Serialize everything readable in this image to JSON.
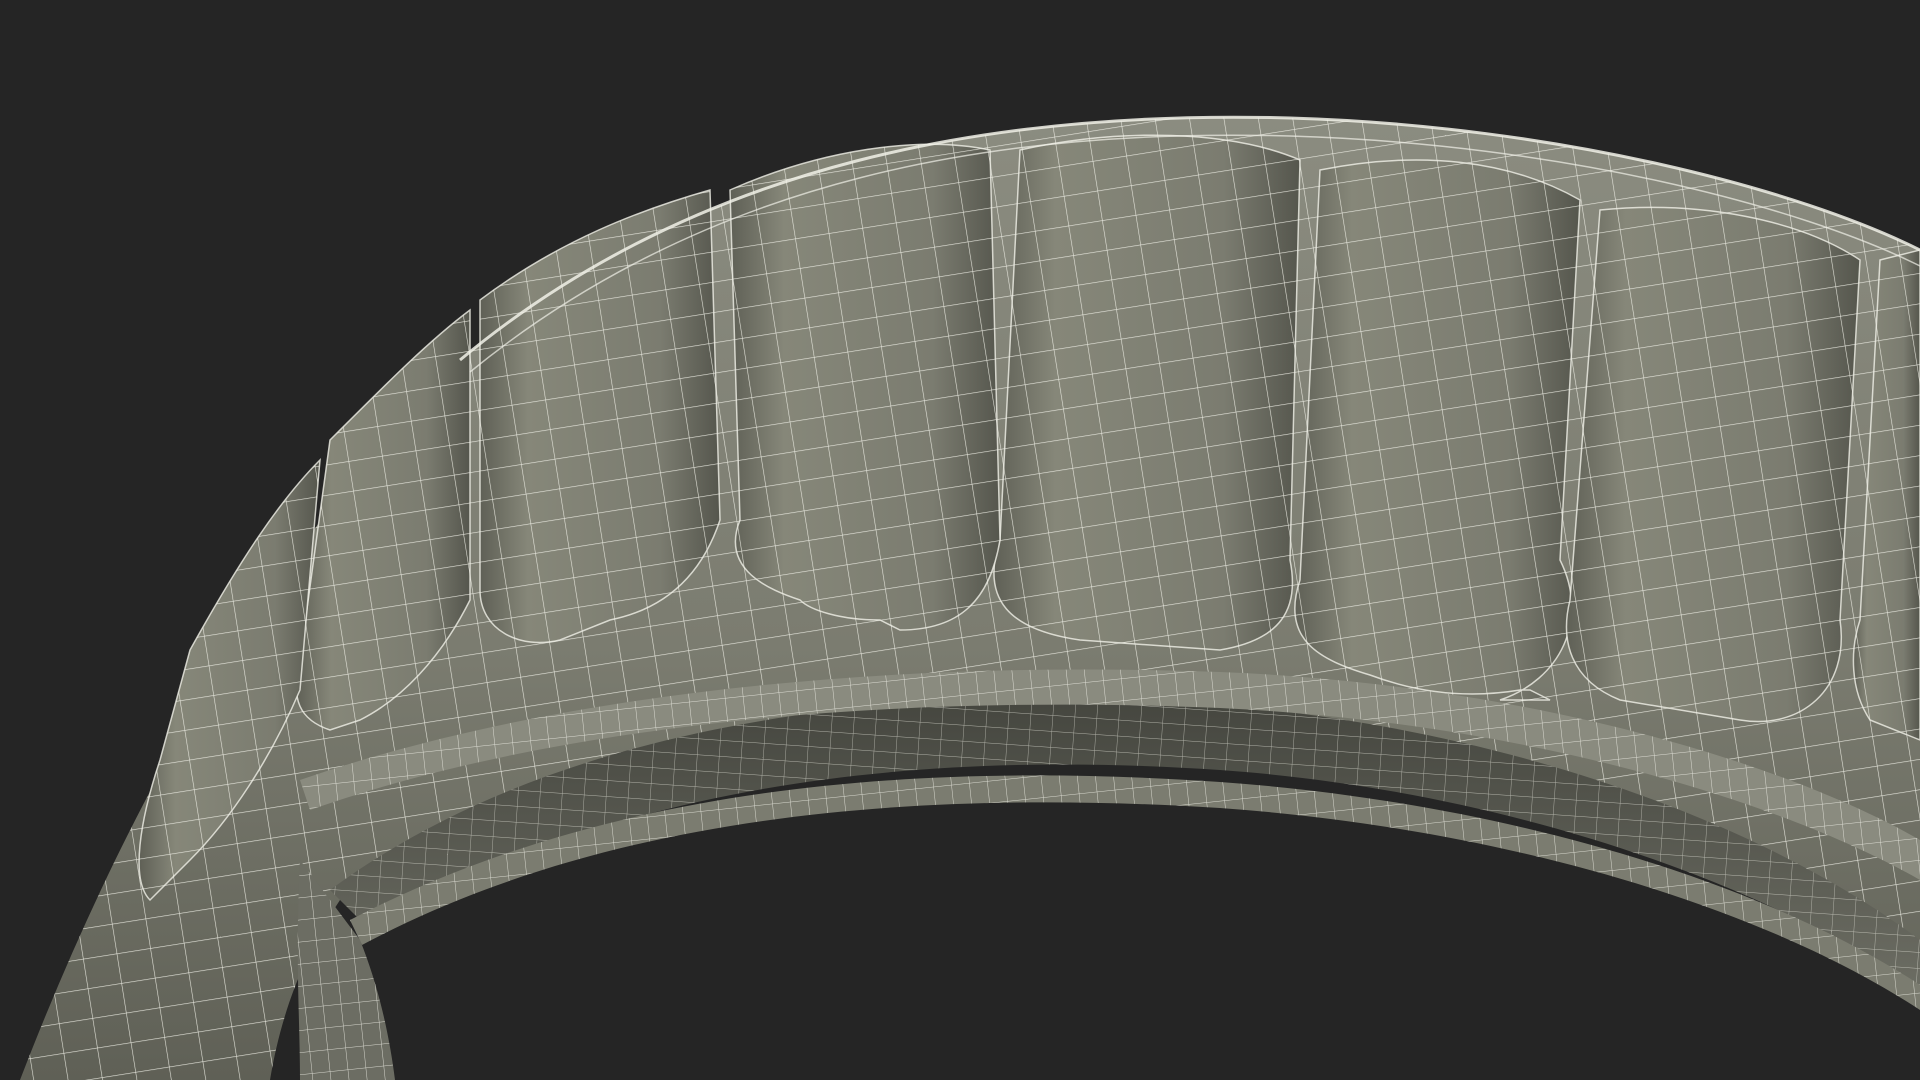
{
  "scene": {
    "subject": "wireframe-render",
    "colors": {
      "background": "#252525",
      "surface": "#7b7c70",
      "surface_light": "#8b8c80",
      "surface_dark": "#5f6056",
      "shadow": "#45463f",
      "inner_surface": "#6c6d63",
      "wire": "#f1f1e8"
    }
  }
}
